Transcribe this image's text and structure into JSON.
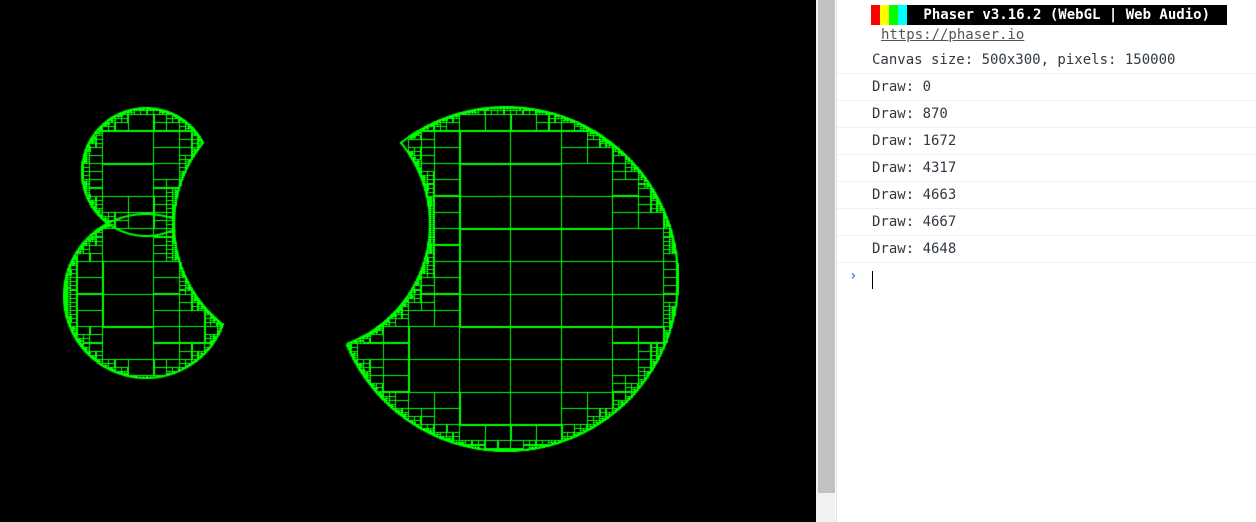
{
  "colors": {
    "game_bg": "#000000",
    "shape_fill": "#00ff00",
    "banner_stripes": [
      "#ff0000",
      "#ffff00",
      "#00ff00",
      "#00ffff"
    ],
    "console_text": "#303942",
    "prompt_accent": "#367cf1"
  },
  "icons": {
    "prompt": "chevron-right-icon"
  },
  "console": {
    "banner": {
      "text": " Phaser v3.16.2 (WebGL | Web Audio) ",
      "link": "https://phaser.io"
    },
    "canvas_info": "Canvas size: 500x300, pixels: 150000",
    "logs": [
      "Draw: 0",
      "Draw: 870",
      "Draw: 1672",
      "Draw: 4317",
      "Draw: 4663",
      "Draw: 4667",
      "Draw: 4648"
    ],
    "prompt_symbol": "›"
  }
}
